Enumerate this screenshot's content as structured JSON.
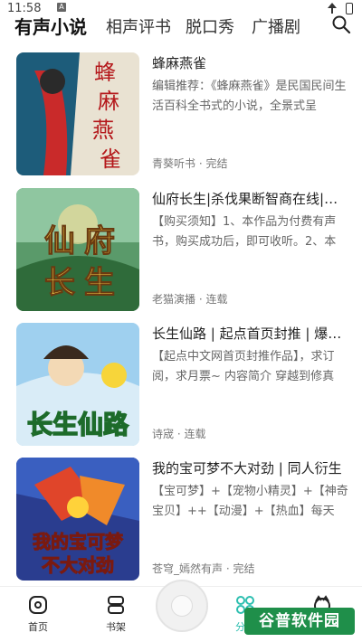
{
  "status_bar": {
    "time": "11:58",
    "badge": "A"
  },
  "top_nav": {
    "tabs": [
      {
        "label": "有声小说",
        "active": true
      },
      {
        "label": "相声评书",
        "active": false
      },
      {
        "label": "脱口秀",
        "active": false
      },
      {
        "label": "广播剧",
        "active": false
      }
    ],
    "search_icon": "search-icon"
  },
  "items": [
    {
      "title": "蜂麻燕雀",
      "description": "编辑推荐：《蜂麻燕雀》是民国民间生活百科全书式的小说，全景式呈",
      "author": "青葵听书",
      "status": "完结",
      "meta": "青葵听书 · 完结",
      "cover_text": "蜂麻燕雀",
      "cover_colors": [
        "#1d5c7a",
        "#c92a2a"
      ]
    },
    {
      "title": "仙府长生|杀伐果断智商在线|爽文",
      "description": "【购买须知】1、本作品为付费有声书，购买成功后，即可收听。2、本",
      "author": "老猫演播",
      "status": "连载",
      "meta": "老猫演播 · 连载",
      "cover_text": "仙府长生",
      "cover_colors": [
        "#2f6b3a",
        "#e8c34a"
      ]
    },
    {
      "title": "长生仙路 | 起点首页封推 | 爆款修仙",
      "description": "【起点中文网首页封推作品】，求订阅，求月票~ 内容简介 穿越到修真",
      "author": "诗宬",
      "status": "连载",
      "meta": "诗宬 · 连载",
      "cover_text": "长生仙路",
      "cover_colors": [
        "#6fb4e0",
        "#f2c23a"
      ]
    },
    {
      "title": "我的宝可梦不大对劲 | 同人衍生",
      "description": "【宝可梦】+【宠物小精灵】+【神奇宝贝】++【动漫】+【热血】每天",
      "author": "苍穹_嫣然有声",
      "status": "完结",
      "meta": "苍穹_嫣然有声 · 完结",
      "cover_text": "我的宝可梦不大对劲",
      "cover_colors": [
        "#2a3d8f",
        "#e0452a"
      ]
    }
  ],
  "bottom_nav": {
    "items": [
      {
        "label": "首页",
        "icon": "home-icon",
        "active": false
      },
      {
        "label": "书架",
        "icon": "bookshelf-icon",
        "active": false
      },
      {
        "label": "分类",
        "icon": "category-icon",
        "active": true
      },
      {
        "label": "我的",
        "icon": "profile-icon",
        "active": false
      }
    ],
    "player_icon": "player-disc-icon"
  },
  "watermark": "谷普软件园",
  "colors": {
    "accent": "#2dbfb0",
    "text": "#222222",
    "muted": "#777777"
  }
}
